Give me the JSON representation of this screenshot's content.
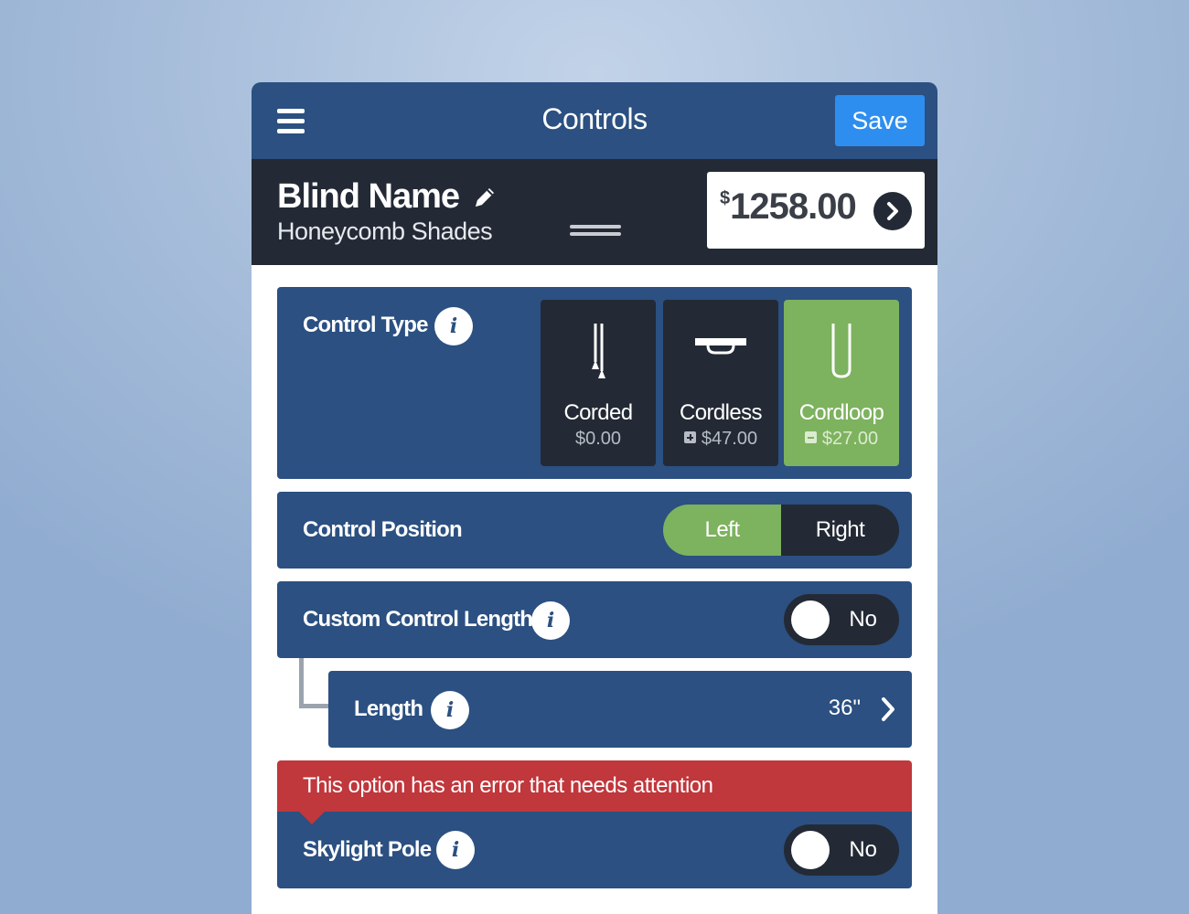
{
  "topbar": {
    "menu_icon": "hamburger-menu-icon",
    "title": "Controls",
    "save_label": "Save"
  },
  "header": {
    "blind_name": "Blind Name",
    "edit_icon": "pencil-icon",
    "subtitle": "Honeycomb Shades",
    "price_currency": "$",
    "price_amount": "1258.00",
    "price_arrow_icon": "chevron-right-icon"
  },
  "control_type": {
    "label": "Control Type",
    "info_glyph": "i",
    "options": [
      {
        "label": "Corded",
        "price": "$0.00",
        "icon": "corded-icon",
        "modifier": "none",
        "selected": false
      },
      {
        "label": "Cordless",
        "price": "$47.00",
        "icon": "cordless-icon",
        "modifier": "plus",
        "selected": false
      },
      {
        "label": "Cordloop",
        "price": "$27.00",
        "icon": "cordloop-icon",
        "modifier": "minus",
        "selected": true
      }
    ]
  },
  "control_position": {
    "label": "Control Position",
    "left_label": "Left",
    "right_label": "Right",
    "selected": "Left"
  },
  "custom_length": {
    "label": "Custom Control Length",
    "info_glyph": "i",
    "toggle_text": "No"
  },
  "length": {
    "label": "Length",
    "info_glyph": "i",
    "value": "36\""
  },
  "error": {
    "message": "This option has an error that needs attention"
  },
  "skylight_pole": {
    "label": "Skylight Pole",
    "info_glyph": "i",
    "toggle_text": "No"
  },
  "colors": {
    "panel_blue": "#2b5081",
    "dark": "#232a35",
    "accent_green": "#7db25f",
    "save_blue": "#2e8ef0",
    "error_red": "#c0373c"
  }
}
